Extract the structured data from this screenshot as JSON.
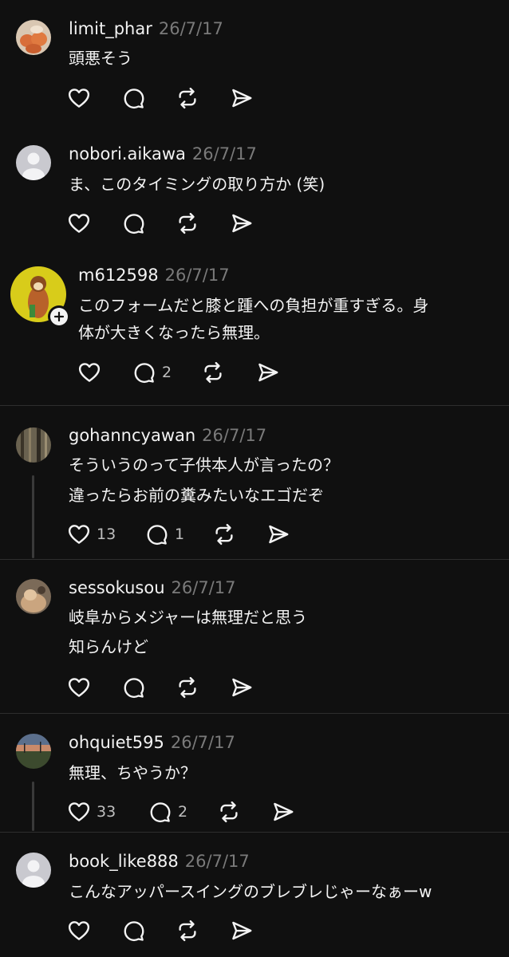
{
  "posts": [
    {
      "username": "limit_phar",
      "date": "26/7/17",
      "lines": [
        "頭悪そう"
      ],
      "likes": "",
      "replies": ""
    },
    {
      "username": "nobori.aikawa",
      "date": "26/7/17",
      "lines": [
        "ま、このタイミングの取り方か (笑)"
      ],
      "likes": "",
      "replies": ""
    },
    {
      "username": "m612598",
      "date": "26/7/17",
      "lines": [
        "このフォームだと膝と踵への負担が重すぎる。身",
        "体が大きくなったら無理。"
      ],
      "likes": "",
      "replies": "2"
    },
    {
      "username": "gohanncyawan",
      "date": "26/7/17",
      "lines": [
        "そういうのって子供本人が言ったの？",
        "違ったらお前の糞みたいなエゴだぞ"
      ],
      "likes": "13",
      "replies": "1"
    },
    {
      "username": "sessokusou",
      "date": "26/7/17",
      "lines": [
        "岐阜からメジャーは無理だと思う",
        "知らんけど"
      ],
      "likes": "",
      "replies": ""
    },
    {
      "username": "ohquiet595",
      "date": "26/7/17",
      "lines": [
        "無理、ちやうか？"
      ],
      "likes": "33",
      "replies": "2"
    },
    {
      "username": "book_like888",
      "date": "26/7/17",
      "lines": [
        "こんなアッパースイングのブレブレじゃーなぁーw"
      ],
      "likes": "",
      "replies": ""
    }
  ],
  "icons": {
    "like": "heart-icon",
    "reply": "comment-icon",
    "repost": "repost-icon",
    "share": "send-icon",
    "follow": "plus-icon"
  },
  "colors": {
    "background": "#101010",
    "text": "#f3f3f3",
    "muted": "#7a7a7a",
    "divider": "#2e2e2e",
    "default_avatar_bg": "#c9c9cf"
  }
}
